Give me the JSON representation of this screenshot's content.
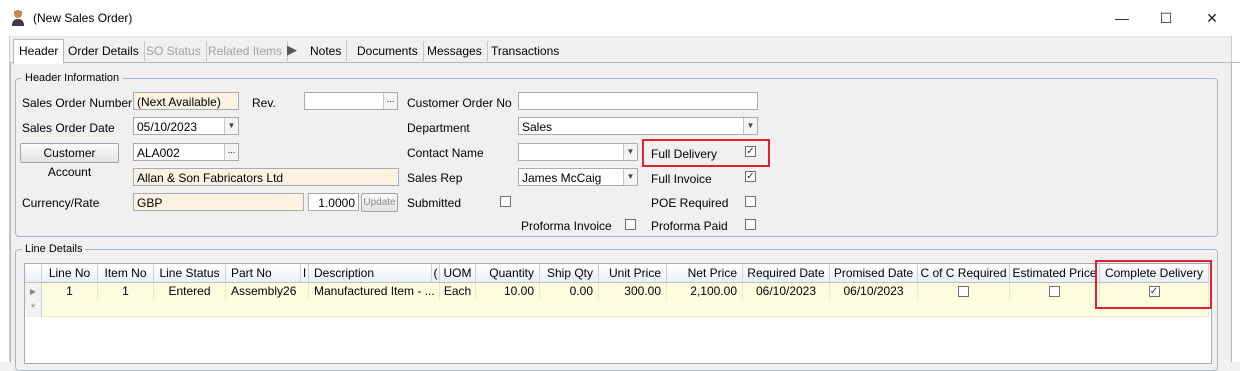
{
  "window": {
    "title": "(New Sales Order)",
    "minimize_glyph": "—",
    "maximize_glyph": "☐",
    "close_glyph": "✕",
    "app_icon": "user-icon"
  },
  "tabs": [
    {
      "label": "Header"
    },
    {
      "label": "Order Details"
    },
    {
      "label": "SO Status"
    },
    {
      "label": "Related Items"
    },
    {
      "label": "Notes"
    },
    {
      "label": "Documents"
    },
    {
      "label": "Messages"
    },
    {
      "label": "Transactions"
    }
  ],
  "header_info": {
    "group_title": "Header Information",
    "sales_order_number": {
      "label": "Sales Order Number",
      "value": "(Next Available)"
    },
    "rev": {
      "label": "Rev.",
      "value": ""
    },
    "sales_order_date": {
      "label": "Sales Order Date",
      "value": "05/10/2023"
    },
    "customer_account": {
      "button_label": "Customer Account",
      "value": "ALA002"
    },
    "customer_name": {
      "value": "Allan & Son Fabricators Ltd"
    },
    "currency_rate": {
      "label": "Currency/Rate",
      "currency": "GBP",
      "rate": "1.0000",
      "update_label": "Update"
    },
    "customer_order_no": {
      "label": "Customer Order No",
      "value": ""
    },
    "department": {
      "label": "Department",
      "value": "Sales"
    },
    "contact_name": {
      "label": "Contact Name",
      "value": ""
    },
    "sales_rep": {
      "label": "Sales Rep",
      "value": "James McCaig"
    },
    "submitted": {
      "label": "Submitted",
      "checked": false
    },
    "proforma_invoice": {
      "label": "Proforma Invoice",
      "checked": false
    },
    "full_delivery": {
      "label": "Full Delivery",
      "checked": true
    },
    "full_invoice": {
      "label": "Full Invoice",
      "checked": true
    },
    "poe_required": {
      "label": "POE Required",
      "checked": false
    },
    "proforma_paid": {
      "label": "Proforma Paid",
      "checked": false
    }
  },
  "line_details": {
    "group_title": "Line Details",
    "columns": [
      "Line No",
      "Item No",
      "Line Status",
      "Part No",
      "I",
      "Description",
      "(",
      "UOM",
      "Quantity",
      "Ship Qty",
      "Unit Price",
      "Net Price",
      "Required Date",
      "Promised Date",
      "C of C Required",
      "Estimated Price",
      "Complete Delivery"
    ],
    "rows": [
      {
        "line_no": "1",
        "item_no": "1",
        "line_status": "Entered",
        "part_no": "Assembly26",
        "description": "Manufactured Item - ...",
        "uom": "Each",
        "quantity": "10.00",
        "ship_qty": "0.00",
        "unit_price": "300.00",
        "net_price": "2,100.00",
        "required_date": "06/10/2023",
        "promised_date": "06/10/2023",
        "coc_required": false,
        "estimated_price": false,
        "complete_delivery": true
      }
    ],
    "new_row_glyph": "*",
    "current_row_glyph": "▶"
  },
  "glyphs": {
    "check": "✓",
    "dropdown": "▼",
    "ellipsis": "...",
    "tab_arrow": "▶"
  },
  "colors": {
    "highlight": "#e0202e",
    "readonly_field": "#fdf1e1",
    "grid_row": "#fffde0"
  }
}
